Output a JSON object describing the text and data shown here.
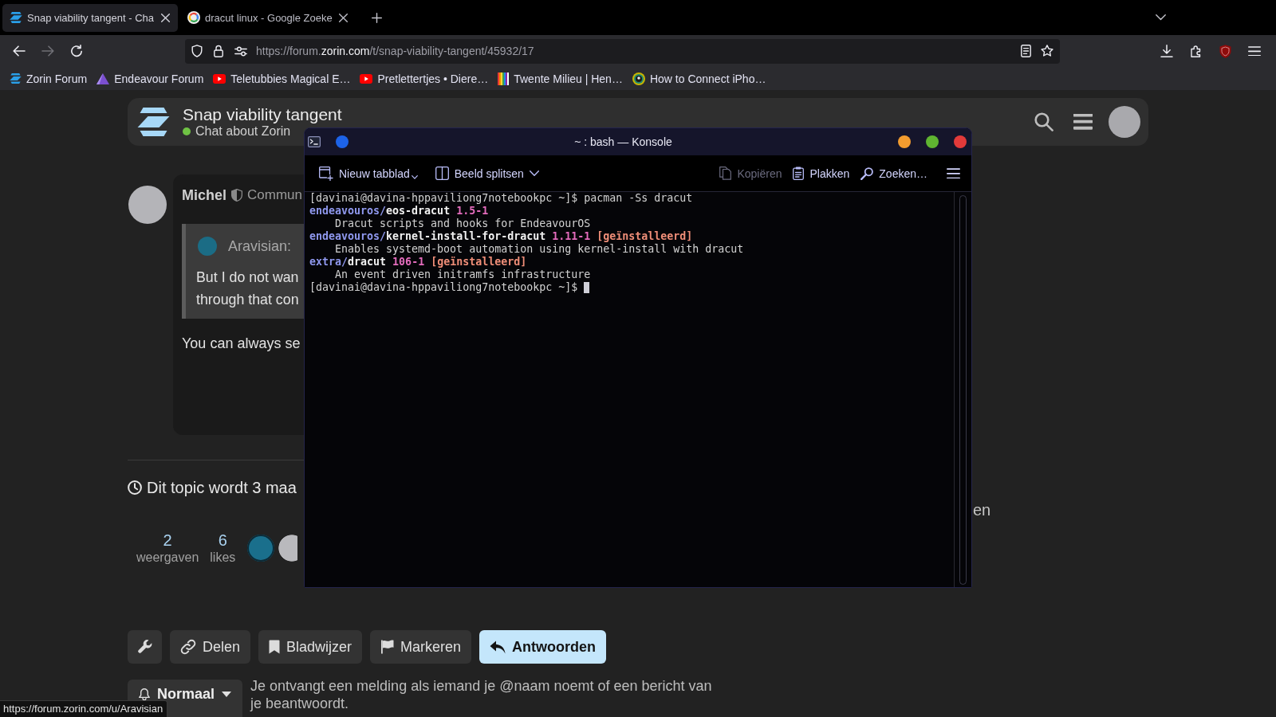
{
  "browser": {
    "tabs": [
      {
        "title": "Snap viability tangent - Cha",
        "selected": true
      },
      {
        "title": "dracut linux - Google Zoeke",
        "selected": false
      }
    ],
    "navigation": {
      "can_go_back": true,
      "can_go_forward": false
    },
    "address": {
      "prefix": "https://forum.",
      "domain": "zorin.com",
      "path": "/t/snap-viability-tangent/45932/17"
    },
    "bookmarks": [
      {
        "label": "Zorin Forum"
      },
      {
        "label": "Endeavour Forum"
      },
      {
        "label": "Teletubbies Magical E…"
      },
      {
        "label": "Pretlettertjes • Diere…"
      },
      {
        "label": "Twente Milieu | Hen…"
      },
      {
        "label": "How to Connect iPho…"
      }
    ]
  },
  "forum": {
    "topic": {
      "title": "Snap viability tangent",
      "category": "Chat about Zorin"
    },
    "post": {
      "author": "Michel",
      "user_title": "Commun",
      "quote": {
        "author": "Aravisian:",
        "lines": [
          "But I do not wan",
          "through that con"
        ]
      },
      "body": "You can always se"
    },
    "timeline": {
      "last_activity": "en"
    },
    "topic_timer": "Dit topic wordt 3 maa",
    "stats": [
      {
        "value": "2",
        "label": "weergaven"
      },
      {
        "value": "6",
        "label": "likes"
      }
    ],
    "footer_buttons": [
      {
        "label": "Delen",
        "kind": "default"
      },
      {
        "label": "Bladwijzer",
        "kind": "default"
      },
      {
        "label": "Markeren",
        "kind": "default"
      },
      {
        "label": "Antwoorden",
        "kind": "primary"
      }
    ],
    "notifications": {
      "option": "Normaal",
      "description": "Je ontvangt een melding als iemand je @naam noemt of een bericht van je beantwoordt."
    }
  },
  "terminal": {
    "title": "~ : bash — Konsole",
    "toolbar": [
      {
        "label": "Nieuw tabblad",
        "disabled": false
      },
      {
        "label": "Beeld splitsen",
        "disabled": false
      },
      {
        "label": "Kopiëren",
        "disabled": true
      },
      {
        "label": "Plakken",
        "disabled": false
      },
      {
        "label": "Zoeken…",
        "disabled": false
      }
    ],
    "input_line": "[davinai@davina-hppaviliong7notebookpc ~]$ pacman -Ss dracut",
    "results": [
      {
        "repo": "endeavouros/",
        "package": "eos-dracut",
        "version": "1.5-1",
        "description": "Dracut scripts and hooks for EndeavourOS"
      },
      {
        "repo": "endeavouros/",
        "package": "kernel-install-for-dracut",
        "version": "1.11-1",
        "status": "[geïnstalleerd]",
        "description": "Enables systemd-boot automation using kernel-install with dracut"
      },
      {
        "repo": "extra/",
        "package": "dracut",
        "version": "106-1",
        "status": "[geïnstalleerd]",
        "description": "An event driven initramfs infrastructure"
      }
    ],
    "current_prompt": "[davinai@davina-hppaviliong7notebookpc ~]$"
  },
  "status_bar": {
    "url": "https://forum.zorin.com/u/Aravisian"
  }
}
